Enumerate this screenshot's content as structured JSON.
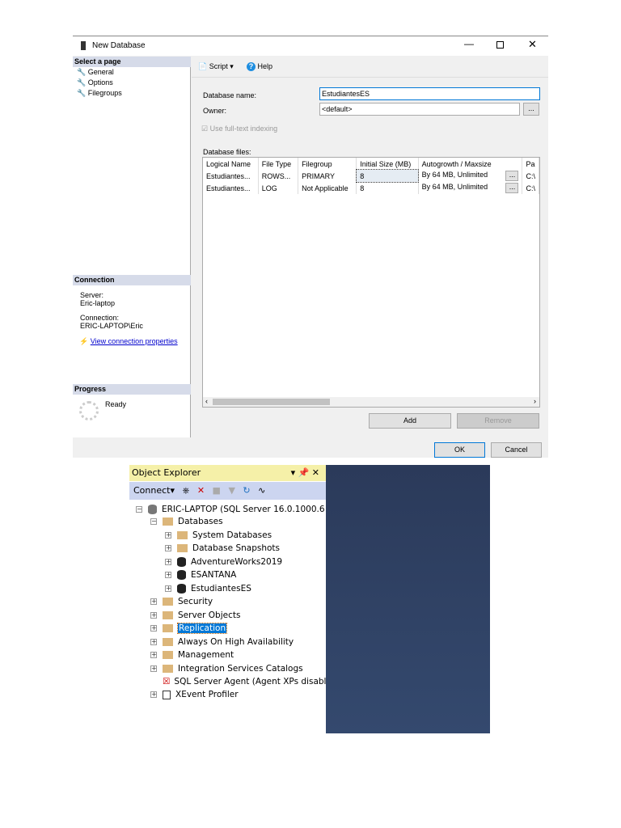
{
  "dialog": {
    "title": "New Database",
    "left": {
      "select_header": "Select a page",
      "pages": [
        "General",
        "Options",
        "Filegroups"
      ],
      "connection_header": "Connection",
      "server_label": "Server:",
      "server": "Eric-laptop",
      "connection_label": "Connection:",
      "connection": "ERIC-LAPTOP\\Eric",
      "view_props": "View connection properties",
      "progress_header": "Progress",
      "progress_status": "Ready"
    },
    "toolbar": {
      "script": "Script",
      "help": "Help"
    },
    "form": {
      "db_name_label": "Database name:",
      "db_name": "EstudiantesES",
      "owner_label": "Owner:",
      "owner": "<default>",
      "fulltext": "Use full-text indexing",
      "files_label": "Database files:"
    },
    "table": {
      "headers": [
        "Logical Name",
        "File Type",
        "Filegroup",
        "Initial Size (MB)",
        "Autogrowth / Maxsize",
        "Pa"
      ],
      "rows": [
        [
          "Estudiantes...",
          "ROWS...",
          "PRIMARY",
          "8",
          "By 64 MB, Unlimited",
          "C:\\"
        ],
        [
          "Estudiantes...",
          "LOG",
          "Not Applicable",
          "8",
          "By 64 MB, Unlimited",
          "C:\\"
        ]
      ]
    },
    "add": "Add",
    "remove": "Remove",
    "ok": "OK",
    "cancel": "Cancel",
    "ellipsis": "..."
  },
  "object_explorer": {
    "title": "Object Explorer",
    "connect": "Connect",
    "nodes": [
      "ERIC-LAPTOP (SQL Server 16.0.1000.6 -",
      "Databases",
      "System Databases",
      "Database Snapshots",
      "AdventureWorks2019",
      "ESANTANA",
      "EstudiantesES",
      "Security",
      "Server Objects",
      "Replication",
      "Always On High Availability",
      "Management",
      "Integration Services Catalogs",
      "SQL Server Agent (Agent XPs disabl",
      "XEvent Profiler"
    ]
  }
}
